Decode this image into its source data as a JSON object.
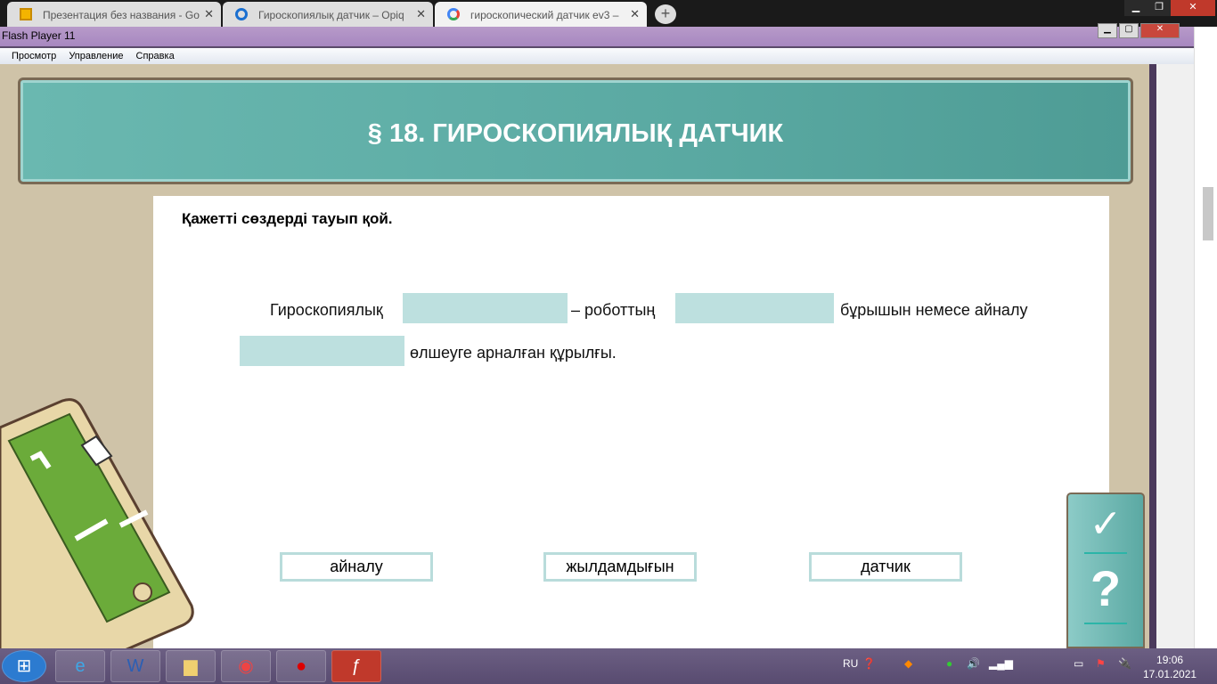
{
  "browser": {
    "tabs": [
      {
        "title": "Презентация без названия - Go"
      },
      {
        "title": "Гироскопиялық датчик – Opiq"
      },
      {
        "title": "гироскопический датчик ev3 – "
      }
    ],
    "new_tab": "+"
  },
  "flash": {
    "title": "Flash Player 11",
    "menu": [
      "Просмотр",
      "Управление",
      "Справка"
    ]
  },
  "lesson": {
    "title": "§ 18. ГИРОСКОПИЯЛЫҚ ДАТЧИК",
    "instruction": "Қажетті сөздерді тауып қой.",
    "sentence": {
      "part1": "Гироскопиялық",
      "part2": "– роботтың",
      "part3": "бұрышын немесе айналу",
      "part4": "өлшеуге арналған құрылғы."
    },
    "words": [
      "айналу",
      "жылдамдығын",
      "датчик"
    ]
  },
  "side_buttons": {
    "check": "✓",
    "help": "?"
  },
  "taskbar": {
    "lang": "RU",
    "time": "19:06",
    "date": "17.01.2021"
  }
}
